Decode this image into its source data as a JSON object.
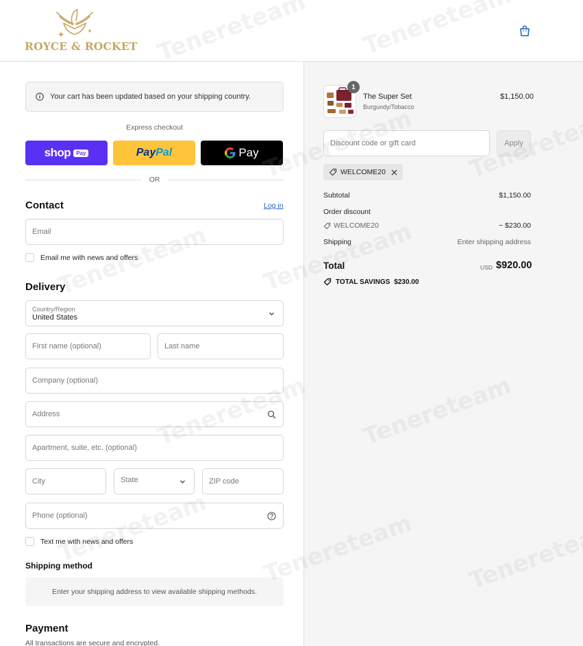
{
  "header": {
    "logo_text": "ROYCE & ROCKET"
  },
  "notice": {
    "text": "Your cart has been updated based on your shipping country."
  },
  "express": {
    "label": "Express checkout",
    "shop_word": "shop",
    "shop_pay": "Pay",
    "paypal_pay": "Pay",
    "paypal_pal": "Pal",
    "gpay_word": "Pay",
    "or_text": "OR"
  },
  "contact": {
    "title": "Contact",
    "login_label": "Log in",
    "email_placeholder": "Email",
    "news_label": "Email me with news and offers"
  },
  "delivery": {
    "title": "Delivery",
    "country_label": "Country/Region",
    "country_value": "United States",
    "first_name": "First name (optional)",
    "last_name": "Last name",
    "company": "Company (optional)",
    "address": "Address",
    "apartment": "Apartment, suite, etc. (optional)",
    "city": "City",
    "state": "State",
    "zip": "ZIP code",
    "phone": "Phone (optional)",
    "sms_label": "Text me with news and offers"
  },
  "shipping": {
    "title": "Shipping method",
    "message": "Enter your shipping address to view available shipping methods."
  },
  "payment": {
    "title": "Payment",
    "subtitle": "All transactions are secure and encrypted."
  },
  "cart": {
    "quantity": "1",
    "product_name": "The Super Set",
    "product_variant": "Burgundy/Tobacco",
    "product_price": "$1,150.00",
    "discount_placeholder": "Discount code or gift card",
    "apply_label": "Apply",
    "applied_code": "WELCOME20",
    "subtotal_label": "Subtotal",
    "subtotal_value": "$1,150.00",
    "order_discount_label": "Order discount",
    "discount_code": "WELCOME20",
    "discount_value": "− $230.00",
    "shipping_label": "Shipping",
    "shipping_value": "Enter shipping address",
    "total_label": "Total",
    "total_currency": "USD",
    "total_value": "$920.00",
    "savings_label": "TOTAL SAVINGS",
    "savings_value": "$230.00"
  },
  "watermark": "Tenereteam",
  "colors": {
    "shop_pay": "#5a31f4",
    "paypal": "#ffc439",
    "gpay": "#000000",
    "link": "#1f5fbf",
    "logo_gold": "#c6a867"
  }
}
